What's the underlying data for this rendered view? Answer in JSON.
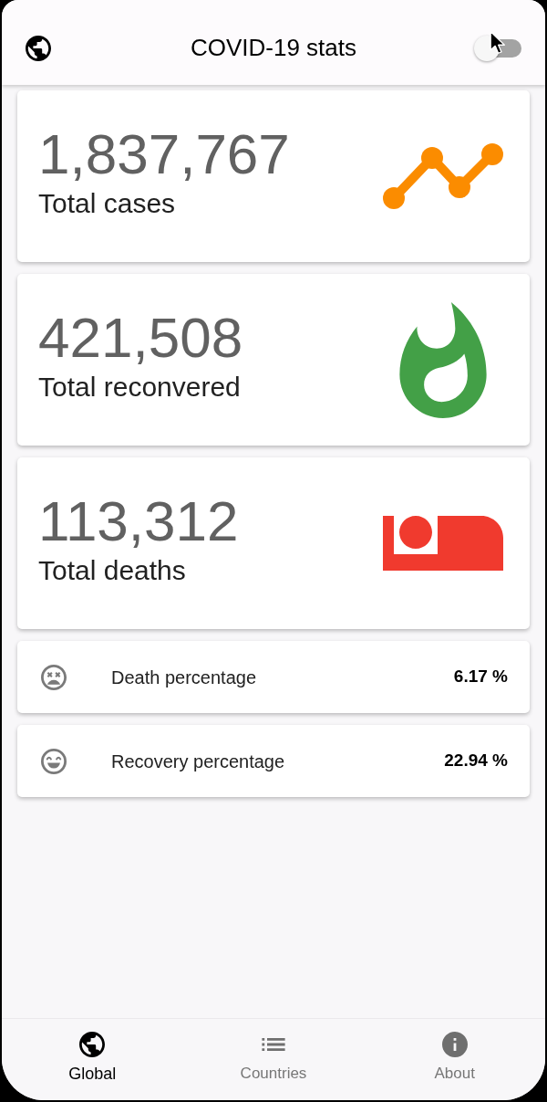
{
  "app_bar": {
    "title": "COVID-19 stats",
    "theme_switch": {
      "on": false
    }
  },
  "stat_cards": [
    {
      "kind": "cases",
      "value": "1,837,767",
      "label": "Total cases",
      "color": "#fb8c00"
    },
    {
      "kind": "recovered",
      "value": "421,508",
      "label": "Total reconvered",
      "color": "#43a047"
    },
    {
      "kind": "deaths",
      "value": "113,312",
      "label": "Total deaths",
      "color": "#f03a2e"
    }
  ],
  "percent_cards": [
    {
      "kind": "death",
      "label": "Death percentage",
      "value": "6.17 %"
    },
    {
      "kind": "recovery",
      "label": "Recovery percentage",
      "value": "22.94 %"
    }
  ],
  "bottom_nav": [
    {
      "kind": "globe",
      "label": "Global",
      "selected": true
    },
    {
      "kind": "list",
      "label": "Countries",
      "selected": false
    },
    {
      "kind": "info",
      "label": "About",
      "selected": false
    }
  ]
}
